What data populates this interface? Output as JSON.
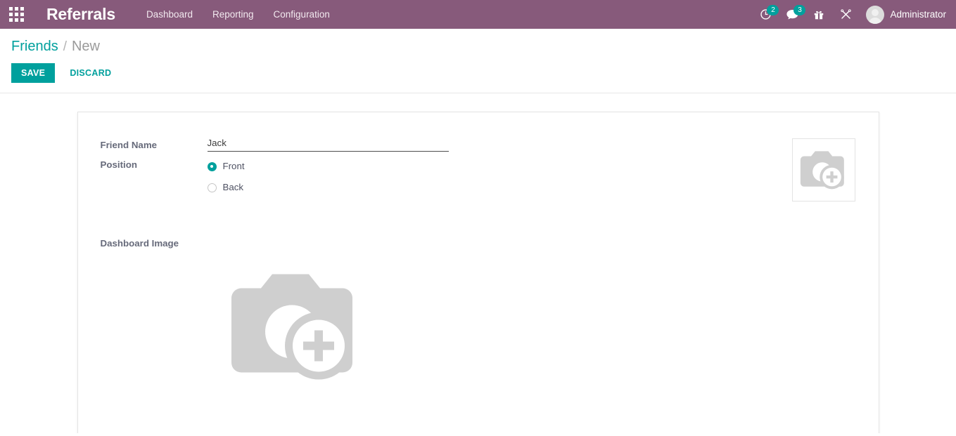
{
  "navbar": {
    "apps_icon": "apps-grid-icon",
    "brand": "Referrals",
    "menu": [
      {
        "label": "Dashboard"
      },
      {
        "label": "Reporting"
      },
      {
        "label": "Configuration"
      }
    ],
    "systray": [
      {
        "icon": "activity-clock-icon",
        "badge": "2"
      },
      {
        "icon": "messages-bubble-icon",
        "badge": "3"
      },
      {
        "icon": "gift-box-icon",
        "badge": ""
      },
      {
        "icon": "debug-tools-icon",
        "badge": ""
      }
    ],
    "user": {
      "avatar_icon": "user-avatar",
      "name": "Administrator"
    }
  },
  "control_panel": {
    "breadcrumb": {
      "root": "Friends",
      "separator": "/",
      "current": "New"
    },
    "save_label": "SAVE",
    "discard_label": "DISCARD"
  },
  "form": {
    "friend_name": {
      "label": "Friend Name",
      "value": "Jack",
      "placeholder": ""
    },
    "position": {
      "label": "Position",
      "options": [
        {
          "label": "Front",
          "selected": true
        },
        {
          "label": "Back",
          "selected": false
        }
      ]
    },
    "avatar_image": {
      "name": "image-upload-small",
      "icon": "camera-add-placeholder-icon"
    },
    "dashboard_image": {
      "label": "Dashboard Image",
      "name": "image-upload-large",
      "icon": "camera-add-placeholder-icon"
    }
  },
  "colors": {
    "navbar_purple": "#875A7B",
    "accent_teal": "#00A09D",
    "label_gray": "#666A7A",
    "placeholder_gray": "#CFCFCF",
    "sheet_border": "#E4E4E4"
  }
}
